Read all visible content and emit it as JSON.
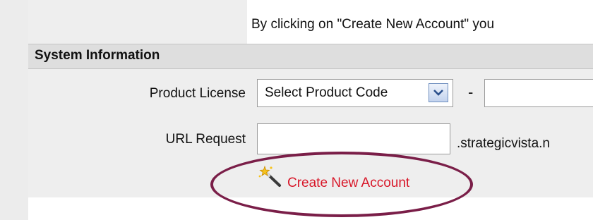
{
  "notice": {
    "text": "By clicking on \"Create New Account\" you"
  },
  "section": {
    "title": "System Information"
  },
  "form": {
    "product_license_label": "Product License",
    "product_select_value": "Select Product Code",
    "separator": "-",
    "product_code_value": "",
    "url_request_label": "URL Request",
    "url_request_value": "",
    "url_domain_suffix": ".strategicvista.n"
  },
  "actions": {
    "create_account_label": "Create New Account"
  },
  "icons": {
    "select_dropdown": "chevron-down-icon",
    "create_account": "magic-wand-icon"
  },
  "colors": {
    "link": "#d8182a",
    "highlight_ring": "#7a1e48",
    "section_bar": "#dedede"
  }
}
